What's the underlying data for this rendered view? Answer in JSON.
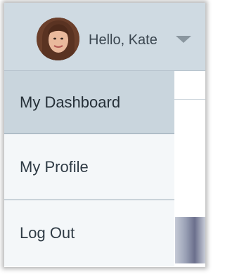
{
  "header": {
    "avatar_icon": "user-avatar-photo",
    "greeting": "Hello, Kate",
    "dropdown_icon": "caret-down-icon"
  },
  "menu": {
    "items": [
      {
        "label": "My Dashboard",
        "active": true
      },
      {
        "label": "My Profile",
        "active": false
      },
      {
        "label": "Log Out",
        "active": false
      }
    ]
  },
  "colors": {
    "header_bg": "#cfdae2",
    "active_item_bg": "#c9d5dd",
    "item_bg": "#f4f7f9",
    "divider": "#98a8b3",
    "text": "#2f3b45"
  }
}
